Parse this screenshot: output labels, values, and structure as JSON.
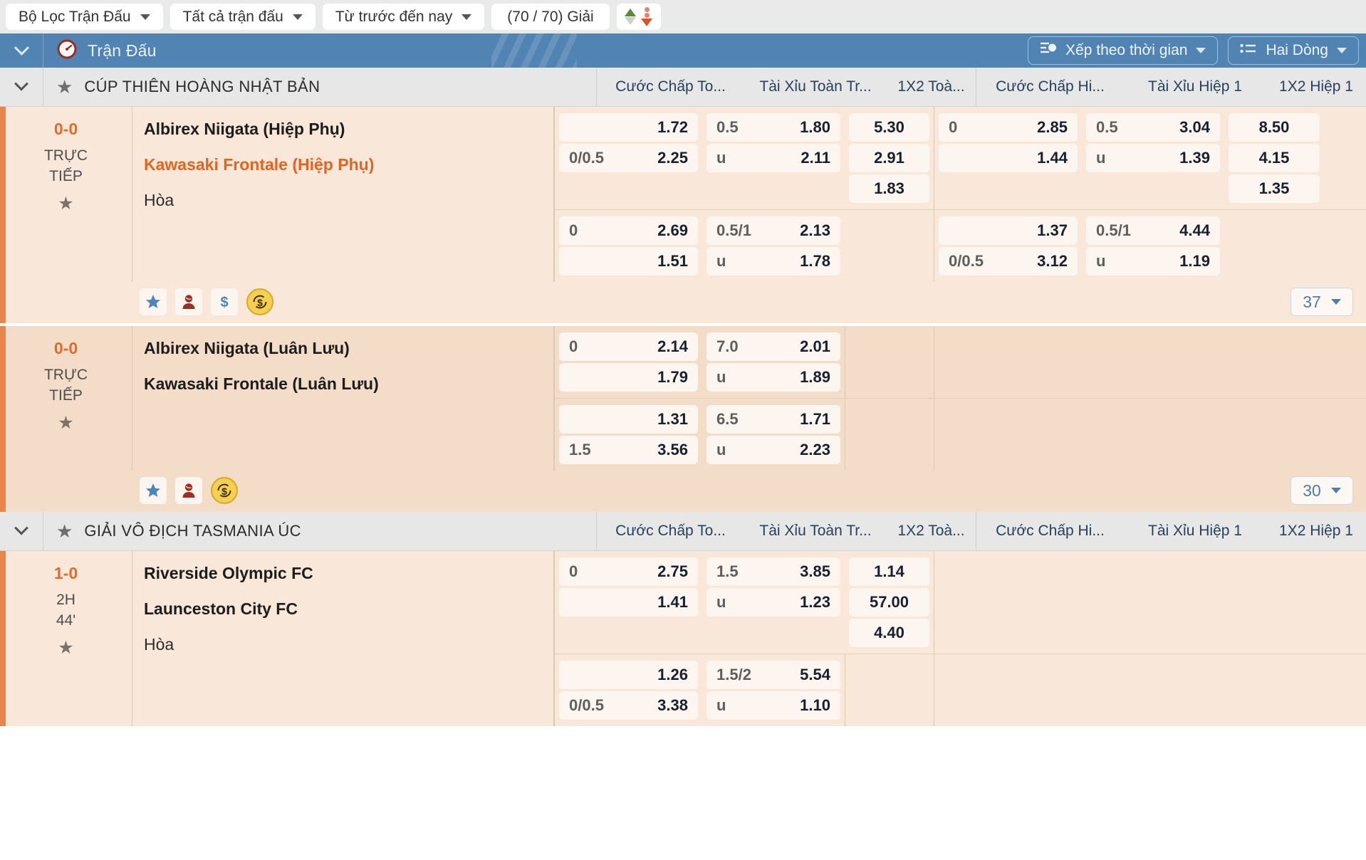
{
  "filter_bar": {
    "chips": [
      {
        "label": "Bộ Lọc Trận Đấu",
        "icon": "chevron-down-icon"
      },
      {
        "label": "Tất cả trận đấu",
        "icon": "chevron-down-icon"
      },
      {
        "label": "Từ trước đến nay",
        "icon": "chevron-down-icon"
      }
    ],
    "league_count": "(70 / 70) Giải",
    "sort_icon": "sort-ascending-descending-icon"
  },
  "section_header": {
    "title": "Trận Đấu",
    "icon": "stopwatch-icon",
    "collapse_icon": "chevron-down-icon",
    "sort_button": {
      "label": "Xếp theo thời gian",
      "icon": "sort-by-time-icon"
    },
    "rows_button": {
      "label": "Hai Dòng",
      "icon": "two-rows-icon"
    },
    "bg_color": "#5183b3"
  },
  "columns": [
    "Cước Chấp To...",
    "Tài Xỉu Toàn Tr...",
    "1X2 Toà...",
    "Cước Chấp Hi...",
    "Tài Xỉu Hiệp 1",
    "1X2 Hiệp 1"
  ],
  "leagues": [
    {
      "name": "CÚP THIÊN HOÀNG NHẬT BẢN",
      "star_icon": "star-icon",
      "collapse_icon": "chevron-down-icon",
      "matches": [
        {
          "score": "0-0",
          "status_line1": "TRỰC",
          "status_line2": "TIẾP",
          "favorite_icon": "star-icon",
          "home": "Albirex Niigata (Hiệp Phụ)",
          "away": "Kawasaki Frontale (Hiệp Phụ)",
          "away_highlighted": true,
          "draw": "Hòa",
          "shade": "light",
          "group1": {
            "ah_full": [
              {
                "h": "",
                "v": "1.72"
              },
              {
                "h": "0/0.5",
                "v": "2.25"
              }
            ],
            "ou_full": [
              {
                "h": "0.5",
                "v": "1.80"
              },
              {
                "h": "u",
                "v": "2.11"
              }
            ],
            "x2_full": [
              "5.30",
              "2.91",
              "1.83"
            ],
            "ah_half": [
              {
                "h": "0",
                "v": "2.85"
              },
              {
                "h": "",
                "v": "1.44"
              }
            ],
            "ou_half": [
              {
                "h": "0.5",
                "v": "3.04"
              },
              {
                "h": "u",
                "v": "1.39"
              }
            ],
            "x2_half": [
              "8.50",
              "4.15",
              "1.35"
            ]
          },
          "group2": {
            "ah_full": [
              {
                "h": "0",
                "v": "2.69"
              },
              {
                "h": "",
                "v": "1.51"
              }
            ],
            "ou_full": [
              {
                "h": "0.5/1",
                "v": "2.13"
              },
              {
                "h": "u",
                "v": "1.78"
              }
            ],
            "x2_full": [],
            "ah_half": [
              {
                "h": "",
                "v": "1.37"
              },
              {
                "h": "0/0.5",
                "v": "3.12"
              }
            ],
            "ou_half": [
              {
                "h": "0.5/1",
                "v": "4.44"
              },
              {
                "h": "u",
                "v": "1.19"
              }
            ],
            "x2_half": []
          },
          "footer": {
            "icons": [
              "star-icon",
              "woman-icon",
              "dollar-icon",
              "coin-refresh-icon"
            ],
            "count": "37",
            "count_chevron": "chevron-down-icon"
          }
        },
        {
          "score": "0-0",
          "status_line1": "TRỰC",
          "status_line2": "TIẾP",
          "favorite_icon": "star-icon",
          "home": "Albirex Niigata (Luân Lưu)",
          "away": "Kawasaki Frontale (Luân Lưu)",
          "away_highlighted": false,
          "draw": "",
          "shade": "dark",
          "group1": {
            "ah_full": [
              {
                "h": "0",
                "v": "2.14"
              },
              {
                "h": "",
                "v": "1.79"
              }
            ],
            "ou_full": [
              {
                "h": "7.0",
                "v": "2.01"
              },
              {
                "h": "u",
                "v": "1.89"
              }
            ],
            "x2_full": [],
            "ah_half": [],
            "ou_half": [],
            "x2_half": []
          },
          "group2": {
            "ah_full": [
              {
                "h": "",
                "v": "1.31"
              },
              {
                "h": "1.5",
                "v": "3.56"
              }
            ],
            "ou_full": [
              {
                "h": "6.5",
                "v": "1.71"
              },
              {
                "h": "u",
                "v": "2.23"
              }
            ],
            "x2_full": [],
            "ah_half": [],
            "ou_half": [],
            "x2_half": []
          },
          "footer": {
            "icons": [
              "star-icon",
              "woman-icon",
              "coin-refresh-icon"
            ],
            "count": "30",
            "count_chevron": "chevron-down-icon"
          }
        }
      ]
    },
    {
      "name": "GIẢI VÔ ĐỊCH TASMANIA ÚC",
      "star_icon": "star-icon",
      "collapse_icon": "chevron-down-icon",
      "matches": [
        {
          "score": "1-0",
          "status_line1": "2H",
          "status_line2": "44'",
          "favorite_icon": "star-icon",
          "home": "Riverside Olympic FC",
          "away": "Launceston City FC",
          "away_highlighted": false,
          "draw": "Hòa",
          "shade": "light",
          "group1": {
            "ah_full": [
              {
                "h": "0",
                "v": "2.75"
              },
              {
                "h": "",
                "v": "1.41"
              }
            ],
            "ou_full": [
              {
                "h": "1.5",
                "v": "3.85"
              },
              {
                "h": "u",
                "v": "1.23"
              }
            ],
            "x2_full": [
              "1.14",
              "57.00",
              "4.40"
            ],
            "ah_half": [],
            "ou_half": [],
            "x2_half": []
          },
          "group2": {
            "ah_full": [
              {
                "h": "",
                "v": "1.26"
              },
              {
                "h": "0/0.5",
                "v": "3.38"
              }
            ],
            "ou_full": [
              {
                "h": "1.5/2",
                "v": "5.54"
              },
              {
                "h": "u",
                "v": "1.10"
              }
            ],
            "x2_full": [],
            "ah_half": [],
            "ou_half": [],
            "x2_half": []
          },
          "footer": null
        }
      ]
    }
  ]
}
